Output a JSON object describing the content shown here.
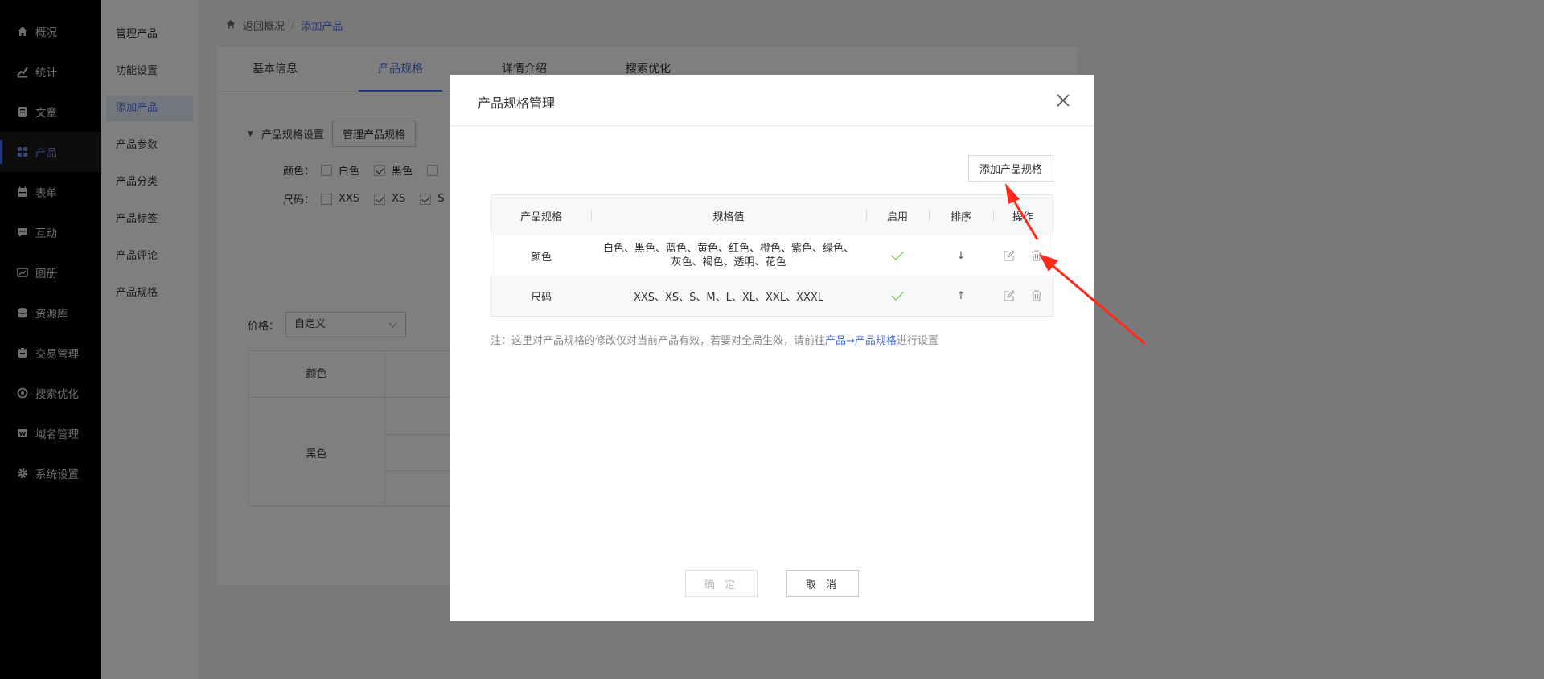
{
  "sidebar": {
    "items": [
      {
        "label": "概况",
        "icon": "home-icon"
      },
      {
        "label": "统计",
        "icon": "chart-icon"
      },
      {
        "label": "文章",
        "icon": "article-icon"
      },
      {
        "label": "产品",
        "icon": "grid-icon"
      },
      {
        "label": "表单",
        "icon": "form-icon"
      },
      {
        "label": "互动",
        "icon": "chat-icon"
      },
      {
        "label": "图册",
        "icon": "album-icon"
      },
      {
        "label": "资源库",
        "icon": "database-icon"
      },
      {
        "label": "交易管理",
        "icon": "trade-icon"
      },
      {
        "label": "搜索优化",
        "icon": "seo-icon"
      },
      {
        "label": "域名管理",
        "icon": "domain-icon"
      },
      {
        "label": "系统设置",
        "icon": "gear-icon"
      }
    ],
    "active_color": "#4a6ee0"
  },
  "submenu": {
    "items": [
      {
        "label": "管理产品"
      },
      {
        "label": "功能设置"
      },
      {
        "label": "添加产品"
      },
      {
        "label": "产品参数"
      },
      {
        "label": "产品分类"
      },
      {
        "label": "产品标签"
      },
      {
        "label": "产品评论"
      },
      {
        "label": "产品规格"
      }
    ]
  },
  "breadcrumb": {
    "back": "返回概况",
    "sep": "/",
    "current": "添加产品"
  },
  "tabs": [
    {
      "label": "基本信息"
    },
    {
      "label": "产品规格"
    },
    {
      "label": "详情介绍"
    },
    {
      "label": "搜索优化"
    }
  ],
  "spec_setting": {
    "label": "产品规格设置",
    "manage_button": "管理产品规格",
    "color_label": "颜色：",
    "color_options": [
      {
        "label": "白色",
        "checked": false
      },
      {
        "label": "黑色",
        "checked": true
      }
    ],
    "size_label": "尺码：",
    "size_options": [
      {
        "label": "XXS",
        "checked": false
      },
      {
        "label": "XS",
        "checked": true
      },
      {
        "label": "S",
        "checked": true
      }
    ]
  },
  "price": {
    "label": "价格：",
    "value": "自定义"
  },
  "bg_table": {
    "col1": "颜色",
    "row1": "黑色"
  },
  "modal": {
    "title": "产品规格管理",
    "add_button": "添加产品规格",
    "columns": [
      "产品规格",
      "规格值",
      "启用",
      "排序",
      "操作"
    ],
    "rows": [
      {
        "spec": "颜色",
        "values": "白色、黑色、蓝色、黄色、红色、橙色、紫色、绿色、灰色、褐色、透明、花色",
        "enabled": true,
        "sort": "↓"
      },
      {
        "spec": "尺码",
        "values": "XXS、XS、S、M、L、XL、XXL、XXXL",
        "enabled": true,
        "sort": "↑"
      }
    ],
    "note_prefix": "注：这里对产品规格的修改仅对当前产品有效，若要对全局生效，请前往",
    "note_link": "产品→产品规格",
    "note_suffix": "进行设置",
    "ok_button": "确 定",
    "cancel_button": "取 消"
  },
  "annotation_color": "#ff2a1a"
}
